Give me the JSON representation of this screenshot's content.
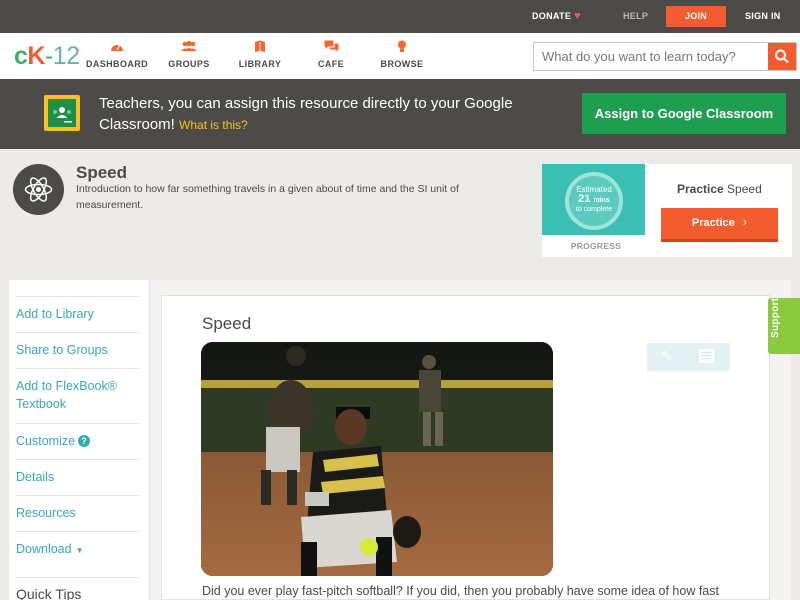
{
  "topbar": {
    "donate": "DONATE",
    "help": "HELP",
    "join": "JOIN",
    "signin": "SIGN IN"
  },
  "nav": {
    "logo": {
      "c": "c",
      "k": "K",
      "dash": "-",
      "n": "12"
    },
    "items": [
      {
        "label": "DASHBOARD",
        "icon": "dashboard-icon"
      },
      {
        "label": "GROUPS",
        "icon": "groups-icon"
      },
      {
        "label": "LIBRARY",
        "icon": "library-icon"
      },
      {
        "label": "CAFE",
        "icon": "cafe-icon"
      },
      {
        "label": "BROWSE",
        "icon": "browse-icon"
      }
    ],
    "search_placeholder": "What do you want to learn today?"
  },
  "classroom": {
    "text": "Teachers, you can assign this resource directly to your Google Classroom!",
    "what": "What is this?",
    "button": "Assign to Google Classroom"
  },
  "concept": {
    "title": "Speed",
    "description": "Introduction to how far something travels in a given about of time and the SI unit of measurement."
  },
  "practice": {
    "estimated": "Estimated",
    "mins": "21",
    "mins_unit": "mins",
    "complete": "to complete",
    "progress_label": "PROGRESS",
    "title_bold": "Practice",
    "title_rest": "Speed",
    "button": "Practice"
  },
  "sidebar": {
    "items": [
      {
        "label": "Add to Library"
      },
      {
        "label": "Share to Groups"
      },
      {
        "label": "Add to FlexBook® Textbook"
      },
      {
        "label": "Customize"
      },
      {
        "label": "Details"
      },
      {
        "label": "Resources"
      },
      {
        "label": "Download"
      }
    ],
    "quick_tips": "Quick Tips"
  },
  "content": {
    "title": "Speed",
    "paragraph": "Did you ever play fast-pitch softball? If you did, then you probably have some idea of how fast"
  },
  "support": "Support",
  "colors": {
    "accent": "#f25c2e",
    "teal": "#3aa7b6",
    "green": "#1e9e50",
    "dark": "#4d4b48"
  }
}
